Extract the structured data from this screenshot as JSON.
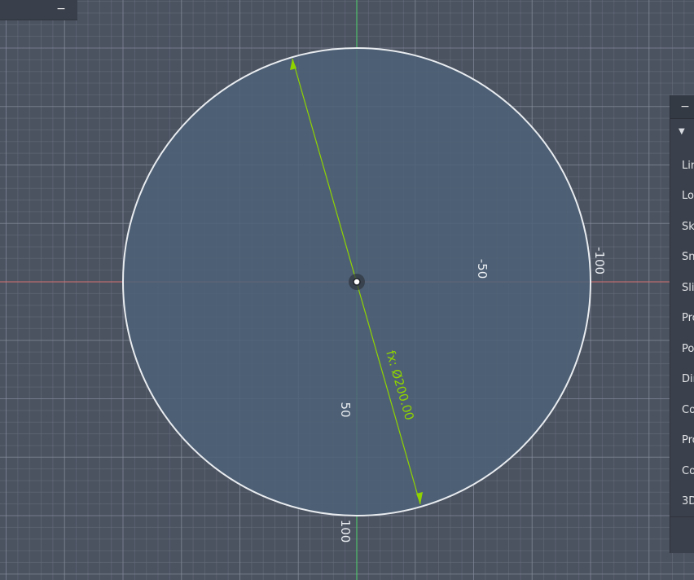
{
  "top_bar": {
    "collapse_symbol": "−"
  },
  "sketch": {
    "axis_labels": [
      {
        "name": "axis-label-minus-50",
        "text": "-50"
      },
      {
        "name": "axis-label-minus-100",
        "text": "-100"
      },
      {
        "name": "axis-label-50",
        "text": "50"
      },
      {
        "name": "axis-label-100",
        "text": "100"
      }
    ],
    "dimension_label": "fx: Ø200.00",
    "colors": {
      "background": "#4b5260",
      "circle_fill": "#4e6178",
      "circle_stroke": "#e8ecf0",
      "dimension": "#8fd400",
      "x_axis": "#d37070",
      "y_axis": "#4cd46a",
      "grid": "#6d7482"
    }
  },
  "right_panel": {
    "collapse_symbol": "−",
    "expand_symbol": "▼",
    "items": [
      "Line",
      "Look",
      "Sketch",
      "Snap",
      "Slice",
      "Profile",
      "Point",
      "Dimension",
      "Constraint",
      "Project",
      "Component",
      "3D"
    ]
  }
}
